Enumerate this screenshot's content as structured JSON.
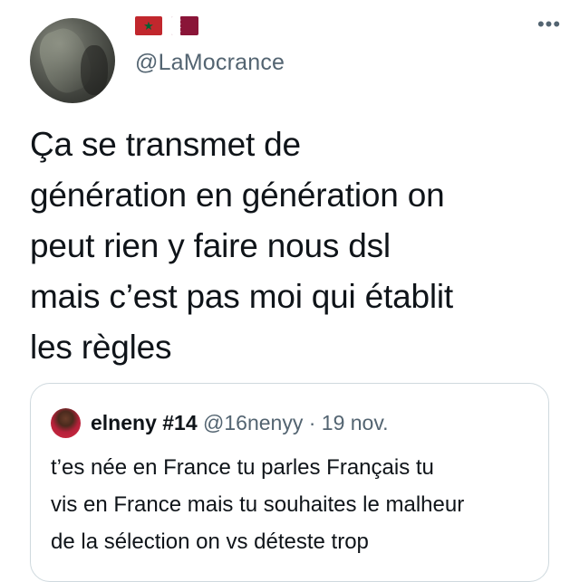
{
  "author": {
    "handle": "@LaMocrance",
    "flag_icons": [
      "morocco-flag-icon",
      "qatar-flag-icon"
    ]
  },
  "menu": {
    "more_label": "•••"
  },
  "tweet": {
    "text": "Ça se transmet de\ngénération en génération on\npeut rien y faire nous dsl\nmais c’est pas moi qui établit\nles règles"
  },
  "quoted_tweet": {
    "name": "elneny #14",
    "handle": "@16nenyy",
    "separator": "·",
    "date": "19 nov.",
    "text": "t’es née en France tu parles Français tu\nvis en France mais tu souhaites le malheur\nde la sélection on vs déteste trop"
  },
  "colors": {
    "text": "#0f1419",
    "secondary_text": "#536471",
    "border": "#cfd9de",
    "morocco_red": "#c1272d",
    "qatar_maroon": "#8a1538"
  }
}
